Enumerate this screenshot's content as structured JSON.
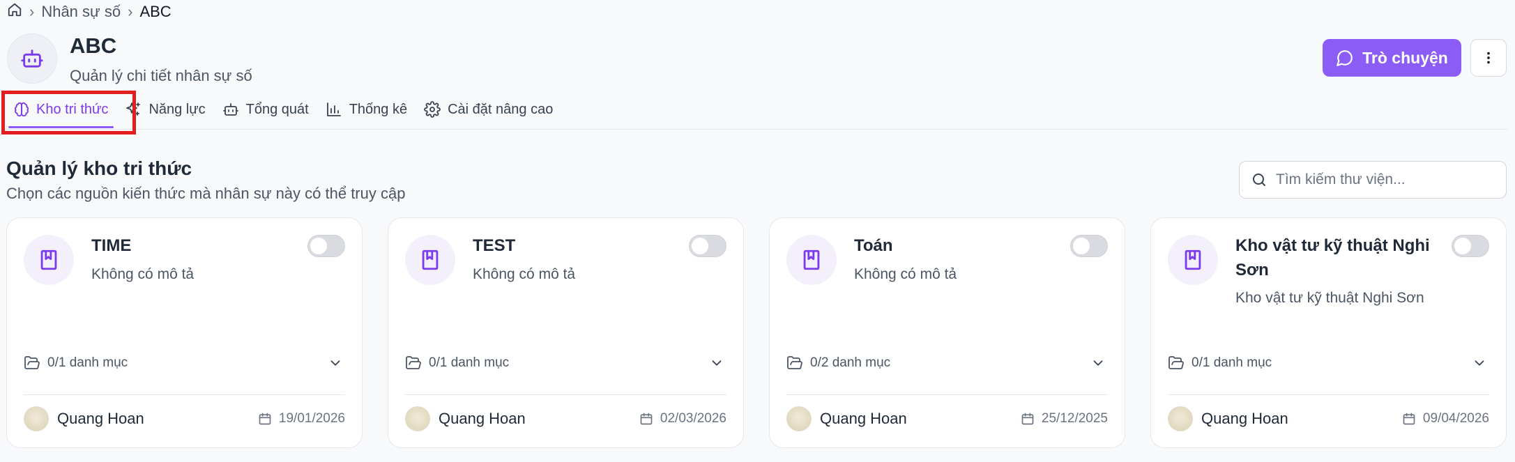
{
  "breadcrumb": {
    "level1": "Nhân sự số",
    "level2": "ABC"
  },
  "header": {
    "title": "ABC",
    "subtitle": "Quản lý chi tiết nhân sự số",
    "chat_button": "Trò chuyện"
  },
  "tabs": [
    {
      "label": "Kho tri thức",
      "icon": "brain-icon"
    },
    {
      "label": "Năng lực",
      "icon": "sparkles-icon"
    },
    {
      "label": "Tổng quát",
      "icon": "bot-icon"
    },
    {
      "label": "Thống kê",
      "icon": "bar-chart-icon"
    },
    {
      "label": "Cài đặt nâng cao",
      "icon": "gear-icon"
    }
  ],
  "section": {
    "title": "Quản lý kho tri thức",
    "description": "Chọn các nguồn kiến thức mà nhân sự này có thể truy cập",
    "search_placeholder": "Tìm kiếm thư viện..."
  },
  "cards": [
    {
      "name": "TIME",
      "description": "Không có mô tả",
      "categories": "0/1 danh mục",
      "owner": "Quang Hoan",
      "date": "19/01/2026",
      "enabled": false
    },
    {
      "name": "TEST",
      "description": "Không có mô tả",
      "categories": "0/1 danh mục",
      "owner": "Quang Hoan",
      "date": "02/03/2026",
      "enabled": false
    },
    {
      "name": "Toán",
      "description": "Không có mô tả",
      "categories": "0/2 danh mục",
      "owner": "Quang Hoan",
      "date": "25/12/2025",
      "enabled": false
    },
    {
      "name": "Kho vật tư kỹ thuật Nghi Sơn",
      "description": "Kho vật tư kỹ thuật Nghi Sơn",
      "categories": "0/1 danh mục",
      "owner": "Quang Hoan",
      "date": "09/04/2026",
      "enabled": false
    }
  ],
  "colors": {
    "accent": "#8b5cf6",
    "highlight": "#e11d1d"
  }
}
